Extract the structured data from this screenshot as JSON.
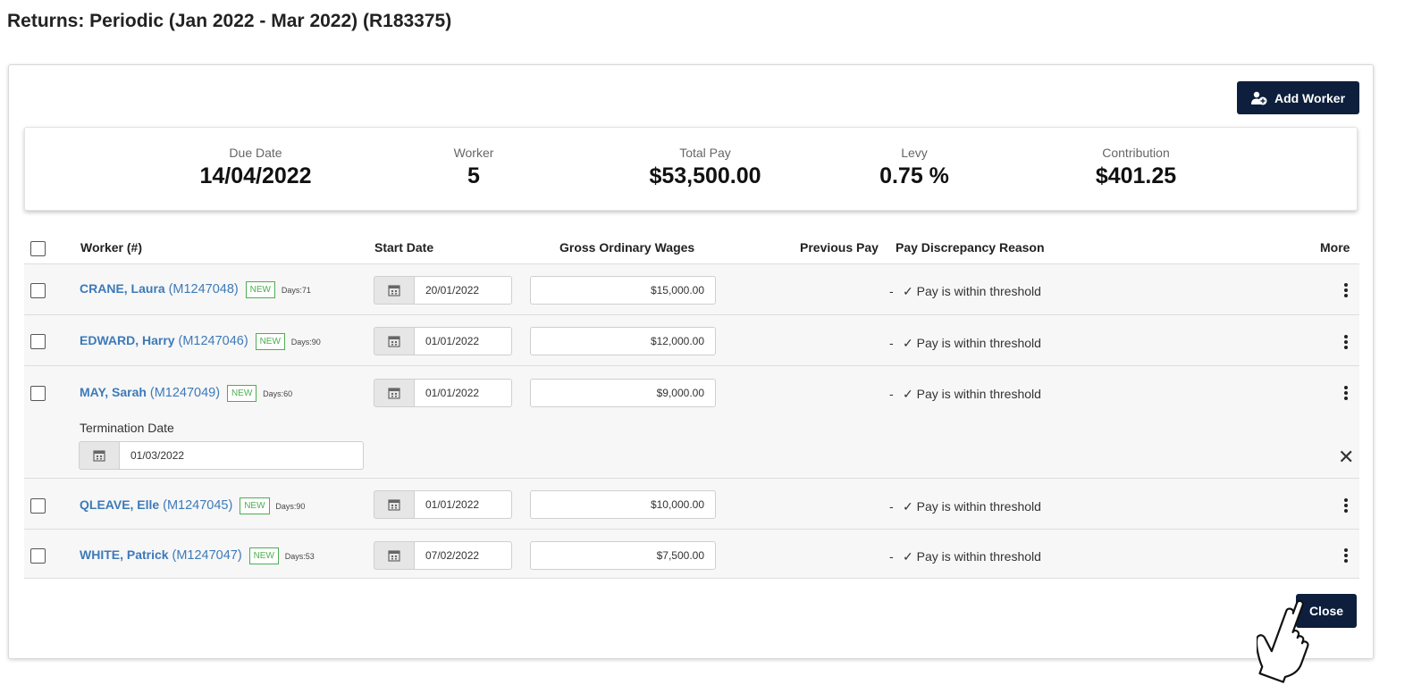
{
  "page": {
    "title": "Returns: Periodic (Jan 2022 - Mar 2022) (R183375)"
  },
  "toolbar": {
    "add_worker_label": "Add Worker",
    "add_worker_icon": "add-user-icon"
  },
  "summary": {
    "due_date": {
      "label": "Due Date",
      "value": "14/04/2022"
    },
    "worker": {
      "label": "Worker",
      "value": "5"
    },
    "total_pay": {
      "label": "Total Pay",
      "value": "$53,500.00"
    },
    "levy": {
      "label": "Levy",
      "value": "0.75 %"
    },
    "contribution": {
      "label": "Contribution",
      "value": "$401.25"
    }
  },
  "table": {
    "headers": {
      "worker": "Worker (#)",
      "start_date": "Start Date",
      "gross_wages": "Gross Ordinary Wages",
      "previous_pay": "Previous Pay",
      "reason": "Pay Discrepancy Reason",
      "more": "More"
    },
    "rows": [
      {
        "name": "CRANE, Laura",
        "id": "(M1247048)",
        "badge": "NEW",
        "days": "Days:71",
        "start_date": "20/01/2022",
        "wages": "$15,000.00",
        "previous_pay": "-",
        "reason": "✓ Pay is within threshold"
      },
      {
        "name": "EDWARD, Harry",
        "id": "(M1247046)",
        "badge": "NEW",
        "days": "Days:90",
        "start_date": "01/01/2022",
        "wages": "$12,000.00",
        "previous_pay": "-",
        "reason": "✓ Pay is within threshold"
      },
      {
        "name": "MAY, Sarah",
        "id": "(M1247049)",
        "badge": "NEW",
        "days": "Days:60",
        "start_date": "01/01/2022",
        "wages": "$9,000.00",
        "previous_pay": "-",
        "reason": "✓ Pay is within threshold",
        "termination_label": "Termination Date",
        "termination_date": "01/03/2022",
        "close_glyph": "✕"
      },
      {
        "name": "QLEAVE, Elle",
        "id": "(M1247045)",
        "badge": "NEW",
        "days": "Days:90",
        "start_date": "01/01/2022",
        "wages": "$10,000.00",
        "previous_pay": "-",
        "reason": "✓ Pay is within threshold"
      },
      {
        "name": "WHITE, Patrick",
        "id": "(M1247047)",
        "badge": "NEW",
        "days": "Days:53",
        "start_date": "07/02/2022",
        "wages": "$7,500.00",
        "previous_pay": "-",
        "reason": "✓ Pay is within threshold"
      }
    ]
  },
  "footer": {
    "close_label": "Close"
  },
  "colors": {
    "primary_button": "#0d1f3c",
    "link": "#3d7ab8",
    "badge": "#4caf50"
  }
}
